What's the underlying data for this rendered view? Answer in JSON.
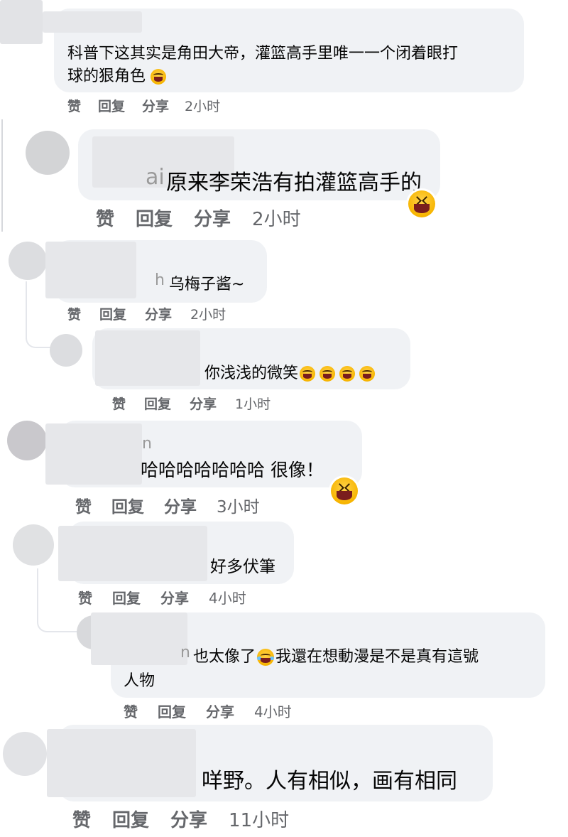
{
  "comments": [
    {
      "text_line1": "科普下这其实是角田大帝，灌篮高手里唯一一个闭着眼打",
      "text_line2": "球的狠角色",
      "like": "赞",
      "reply": "回复",
      "share": "分享",
      "time": "2小时"
    },
    {
      "name_tail": "ai",
      "text": "原来李荣浩有拍灌篮高手的",
      "like": "赞",
      "reply": "回复",
      "share": "分享",
      "time": "2小时"
    },
    {
      "name_tail": "h",
      "text": "乌梅子酱~",
      "like": "赞",
      "reply": "回复",
      "share": "分享",
      "time": "2小时"
    },
    {
      "text": "你浅浅的微笑",
      "like": "赞",
      "reply": "回复",
      "share": "分享",
      "time": "1小时"
    },
    {
      "name_tail": "n",
      "text": "哈哈哈哈哈哈哈 很像！",
      "like": "赞",
      "reply": "回复",
      "share": "分享",
      "time": "3小时"
    },
    {
      "text": "好多伏筆",
      "like": "赞",
      "reply": "回复",
      "share": "分享",
      "time": "4小时"
    },
    {
      "name_tail": "n",
      "text_part1": "也太像了",
      "text_part2": "我還在想動漫是不是真有這號",
      "text_line2": "人物",
      "like": "赞",
      "reply": "回复",
      "share": "分享",
      "time": "4小时"
    },
    {
      "text": "咩野。人有相似，画有相同",
      "like": "赞",
      "reply": "回复",
      "share": "分享",
      "time": "11小时"
    }
  ],
  "emoji_names": [
    "rofl-emoji",
    "laughing-emoji",
    "joy-emoji"
  ]
}
